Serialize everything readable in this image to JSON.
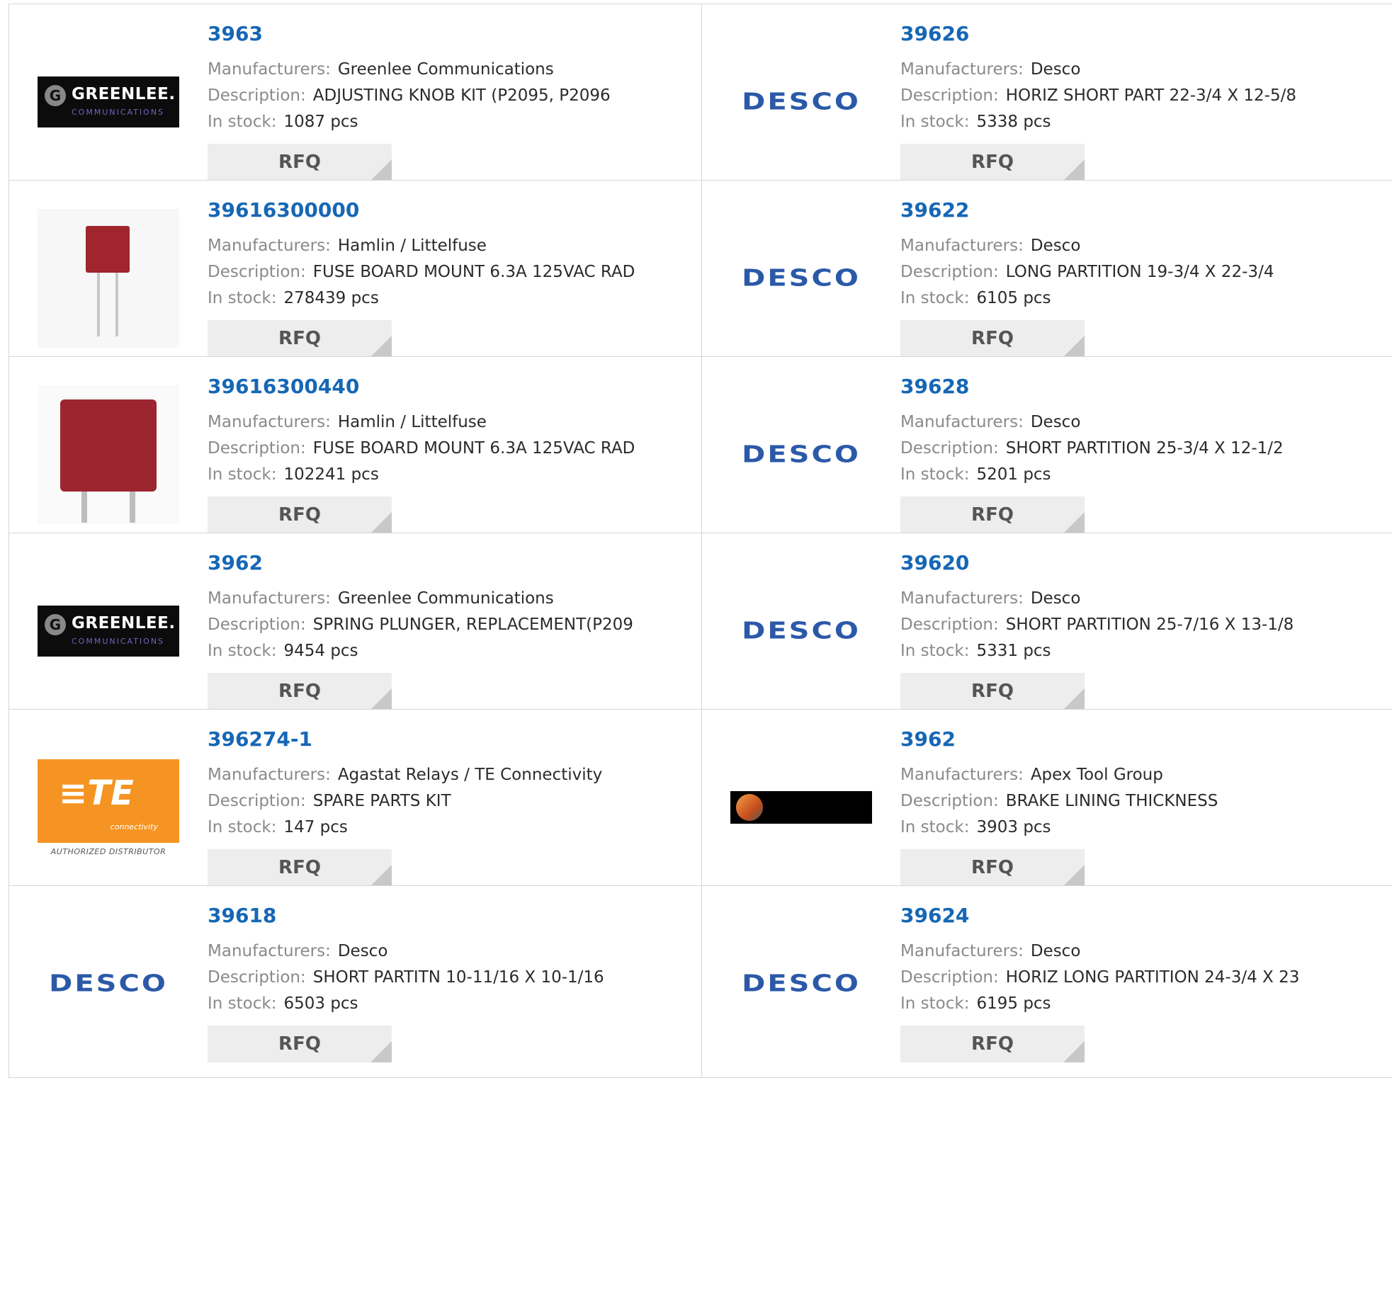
{
  "labels": {
    "manufacturers": "Manufacturers:",
    "description": "Description:",
    "in_stock": "In stock:",
    "rfq": "RFQ"
  },
  "colors": {
    "part_link": "#1667b5",
    "border": "#d6d6d6",
    "rfq_bg": "#ededed"
  },
  "rows": [
    {
      "left": {
        "part": "3963",
        "manufacturer": "Greenlee Communications",
        "description": "ADJUSTING KNOB KIT (P2095, P2096",
        "stock": "1087 pcs",
        "logo": "greenlee-logo"
      },
      "right": {
        "part": "39626",
        "manufacturer": "Desco",
        "description": "HORIZ SHORT PART 22-3/4 X 12-5/8",
        "stock": "5338 pcs",
        "logo": "desco-logo",
        "logo_text": "DESCO"
      }
    },
    {
      "left": {
        "part": "39616300000",
        "manufacturer": "Hamlin / Littelfuse",
        "description": "FUSE BOARD MOUNT 6.3A 125VAC RAD",
        "stock": "278439 pcs",
        "logo": "fuse-small-image"
      },
      "right": {
        "part": "39622",
        "manufacturer": "Desco",
        "description": "LONG PARTITION 19-3/4 X 22-3/4",
        "stock": "6105 pcs",
        "logo": "desco-logo",
        "logo_text": "DESCO"
      }
    },
    {
      "left": {
        "part": "39616300440",
        "manufacturer": "Hamlin / Littelfuse",
        "description": "FUSE BOARD MOUNT 6.3A 125VAC RAD",
        "stock": "102241 pcs",
        "logo": "fuse-large-image"
      },
      "right": {
        "part": "39628",
        "manufacturer": "Desco",
        "description": "SHORT PARTITION 25-3/4 X 12-1/2",
        "stock": "5201 pcs",
        "logo": "desco-logo",
        "logo_text": "DESCO"
      }
    },
    {
      "left": {
        "part": "3962",
        "manufacturer": "Greenlee Communications",
        "description": "SPRING PLUNGER, REPLACEMENT(P209",
        "stock": "9454 pcs",
        "logo": "greenlee-logo"
      },
      "right": {
        "part": "39620",
        "manufacturer": "Desco",
        "description": "SHORT PARTITION 25-7/16 X 13-1/8",
        "stock": "5331 pcs",
        "logo": "desco-logo",
        "logo_text": "DESCO"
      }
    },
    {
      "left": {
        "part": "396274-1",
        "manufacturer": "Agastat Relays / TE Connectivity",
        "description": "SPARE PARTS KIT",
        "stock": "147 pcs",
        "logo": "te-connectivity-logo"
      },
      "right": {
        "part": "3962",
        "manufacturer": "Apex Tool Group",
        "description": "BRAKE LINING THICKNESS",
        "stock": "3903 pcs",
        "logo": "apex-tool-group-logo"
      }
    },
    {
      "left": {
        "part": "39618",
        "manufacturer": "Desco",
        "description": "SHORT PARTITN 10-11/16 X 10-1/16",
        "stock": "6503 pcs",
        "logo": "desco-logo",
        "logo_text": "DESCO"
      },
      "right": {
        "part": "39624",
        "manufacturer": "Desco",
        "description": "HORIZ LONG PARTITION 24-3/4 X 23",
        "stock": "6195 pcs",
        "logo": "desco-logo",
        "logo_text": "DESCO"
      }
    }
  ],
  "logo_art": {
    "greenlee": {
      "g": "G",
      "name": "GREENLEE.",
      "sub": "COMMUNICATIONS"
    },
    "te": {
      "mark": "≡TE",
      "sub": "connectivity",
      "auth": "AUTHORIZED DISTRIBUTOR"
    }
  }
}
